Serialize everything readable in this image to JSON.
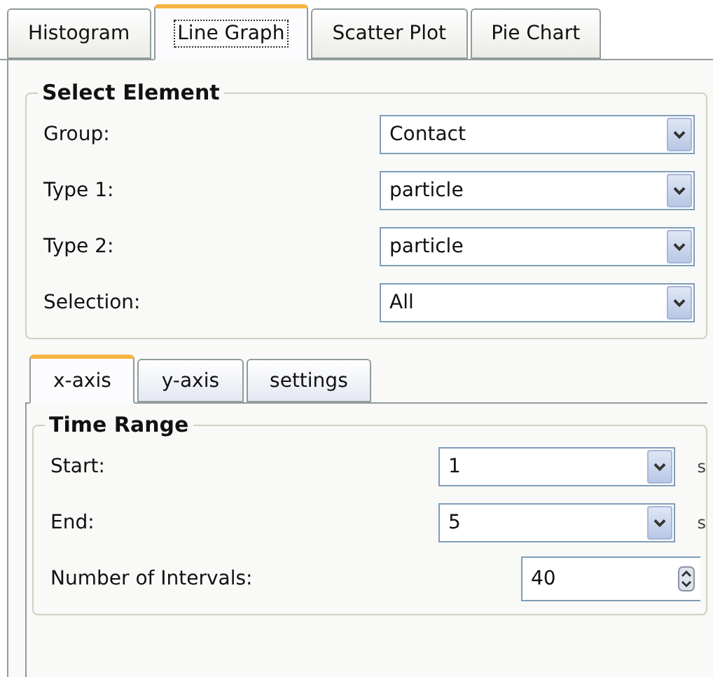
{
  "tabs": [
    {
      "label": "Histogram",
      "selected": false
    },
    {
      "label": "Line Graph",
      "selected": true
    },
    {
      "label": "Scatter Plot",
      "selected": false
    },
    {
      "label": "Pie Chart",
      "selected": false
    }
  ],
  "select_element": {
    "title": "Select Element",
    "fields": [
      {
        "label": "Group:",
        "value": "Contact"
      },
      {
        "label": "Type 1:",
        "value": "particle"
      },
      {
        "label": "Type 2:",
        "value": "particle"
      },
      {
        "label": "Selection:",
        "value": "All"
      }
    ]
  },
  "axis_tabs": [
    {
      "label": "x-axis",
      "selected": true
    },
    {
      "label": "y-axis",
      "selected": false
    },
    {
      "label": "settings",
      "selected": false
    }
  ],
  "time_range": {
    "title": "Time Range",
    "fields": [
      {
        "kind": "dropdown",
        "label": "Start:",
        "value": "1",
        "unit": "s"
      },
      {
        "kind": "dropdown",
        "label": "End:",
        "value": "5",
        "unit": "s"
      },
      {
        "kind": "spinner",
        "label": "Number of Intervals:",
        "value": "40"
      }
    ]
  }
}
